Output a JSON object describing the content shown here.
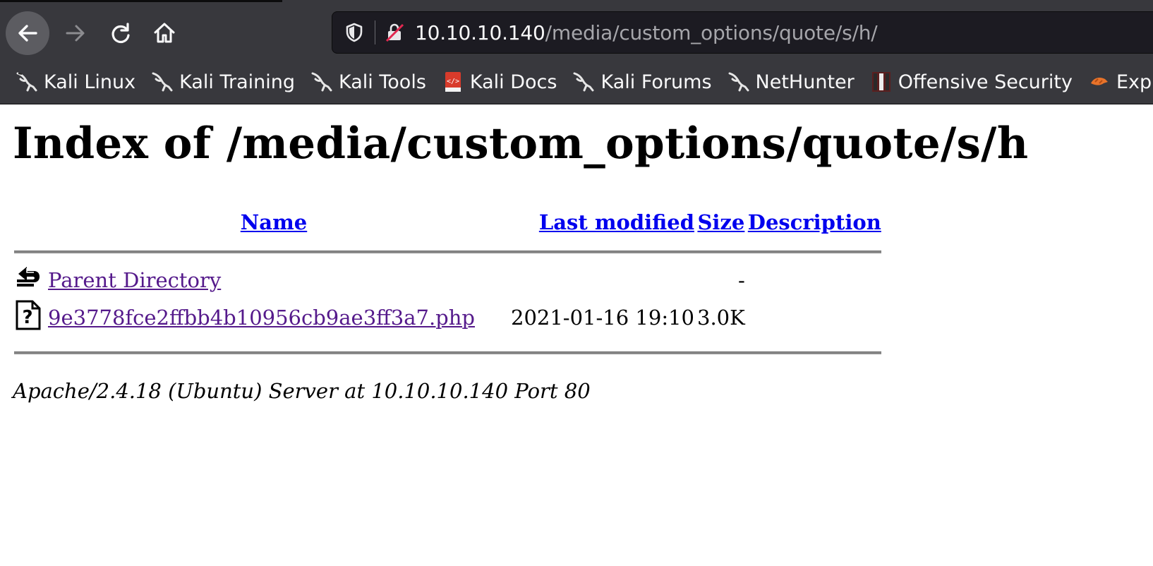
{
  "browser": {
    "url_host": "10.10.10.140",
    "url_path": "/media/custom_options/quote/s/h/",
    "bookmarks": [
      {
        "label": "Kali Linux",
        "icon": "kali-dragon-icon"
      },
      {
        "label": "Kali Training",
        "icon": "kali-dragon-icon"
      },
      {
        "label": "Kali Tools",
        "icon": "kali-dragon-icon"
      },
      {
        "label": "Kali Docs",
        "icon": "kali-docs-icon"
      },
      {
        "label": "Kali Forums",
        "icon": "kali-dragon-icon"
      },
      {
        "label": "NetHunter",
        "icon": "kali-dragon-icon"
      },
      {
        "label": "Offensive Security",
        "icon": "offsec-icon"
      },
      {
        "label": "Exp",
        "icon": "exploit-db-icon"
      }
    ]
  },
  "page": {
    "title": "Index of /media/custom_options/quote/s/h",
    "columns": {
      "name": "Name",
      "last_modified": "Last modified",
      "size": "Size",
      "description": "Description"
    },
    "rows": [
      {
        "icon": "parent-directory-icon",
        "name": "Parent Directory",
        "last_modified": "",
        "size": "-",
        "description": ""
      },
      {
        "icon": "unknown-file-icon",
        "name": "9e3778fce2ffbb4b10956cb9ae3ff3a7.php",
        "last_modified": "2021-01-16 19:10",
        "size": "3.0K",
        "description": ""
      }
    ],
    "footer": "Apache/2.4.18 (Ubuntu) Server at 10.10.10.140 Port 80"
  }
}
